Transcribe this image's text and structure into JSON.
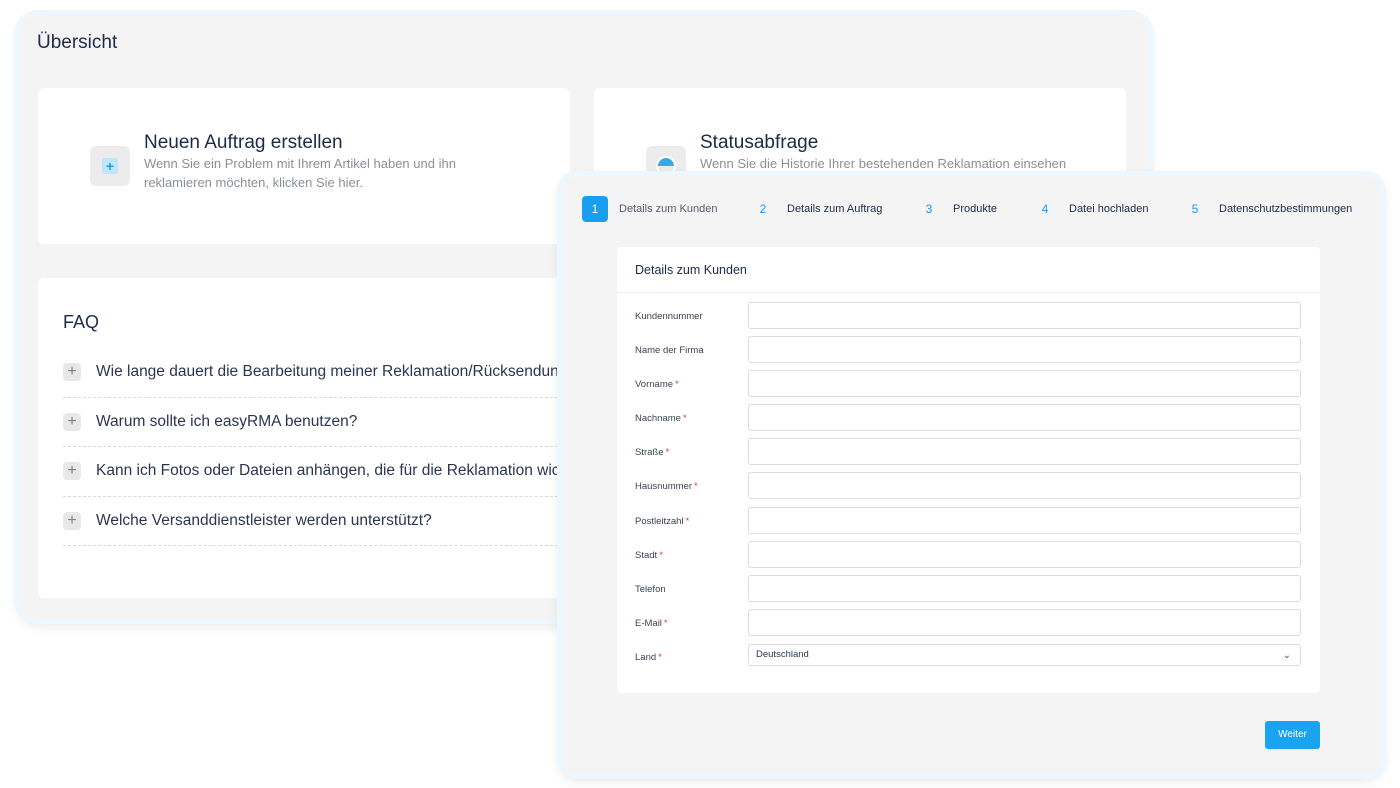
{
  "overview": {
    "title": "Übersicht",
    "new_order": {
      "heading": "Neuen Auftrag erstellen",
      "text": "Wenn Sie ein Problem mit Ihrem Artikel haben und ihn reklamieren möchten, klicken Sie hier.",
      "icon": "plus-icon"
    },
    "status": {
      "heading": "Statusabfrage",
      "text": "Wenn Sie die Historie Ihrer bestehenden Reklamation einsehen",
      "icon": "status-icon"
    },
    "faq": {
      "title": "FAQ",
      "items": [
        "Wie lange dauert die Bearbeitung meiner Reklamation/Rücksendung?",
        "Warum sollte ich easyRMA benutzen?",
        "Kann ich Fotos oder Dateien anhängen, die für die Reklamation wichti",
        "Welche Versanddienstleister werden unterstützt?"
      ]
    }
  },
  "wizard": {
    "steps": [
      {
        "num": "1",
        "label": "Details zum Kunden",
        "active": true
      },
      {
        "num": "2",
        "label": "Details zum Auftrag",
        "active": false
      },
      {
        "num": "3",
        "label": "Produkte",
        "active": false
      },
      {
        "num": "4",
        "label": "Datei hochladen",
        "active": false
      },
      {
        "num": "5",
        "label": "Datenschutzbestimmungen",
        "active": false
      }
    ],
    "form": {
      "title": "Details zum Kunden",
      "required_mark": "*",
      "fields": [
        {
          "label": "Kundennummer",
          "required": false,
          "value": ""
        },
        {
          "label": "Name der Firma",
          "required": false,
          "value": ""
        },
        {
          "label": "Vorname",
          "required": true,
          "value": ""
        },
        {
          "label": "Nachname",
          "required": true,
          "value": ""
        },
        {
          "label": "Straße",
          "required": true,
          "value": ""
        },
        {
          "label": "Hausnummer",
          "required": true,
          "value": ""
        },
        {
          "label": "Postleitzahl",
          "required": true,
          "value": ""
        },
        {
          "label": "Stadt",
          "required": true,
          "value": ""
        },
        {
          "label": "Telefon",
          "required": false,
          "value": ""
        },
        {
          "label": "E-Mail",
          "required": true,
          "value": ""
        }
      ],
      "country": {
        "label": "Land",
        "required": true,
        "selected": "Deutschland"
      }
    },
    "next_label": "Weiter"
  },
  "colors": {
    "accent": "#1aa3f0",
    "required": "#e0394b",
    "panel_bg": "#f4f4f4"
  }
}
